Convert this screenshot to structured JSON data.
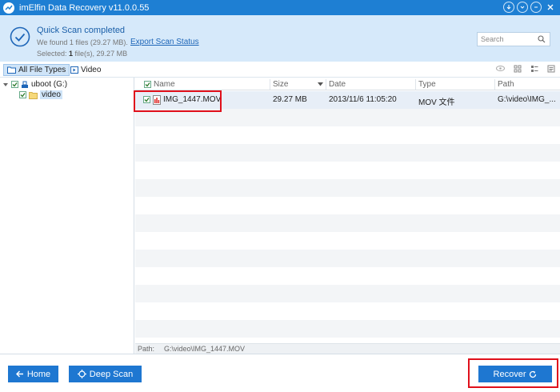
{
  "window": {
    "title": "imElfin Data Recovery v11.0.0.55"
  },
  "header": {
    "status_title": "Quick Scan completed",
    "found_text": "We found 1 files (29.27 MB).",
    "selected_prefix": "Selected: ",
    "selected_count": "1",
    "selected_suffix": " file(s), 29.27 MB",
    "export_link": "Export Scan Status",
    "search_placeholder": "Search"
  },
  "type_tabs": [
    {
      "label": "All File Types",
      "active": true
    },
    {
      "label": "Video",
      "active": false
    }
  ],
  "tree": {
    "drive_label": "uboot (G:)",
    "folder_label": "video"
  },
  "table": {
    "columns": [
      "Name",
      "Size",
      "Date",
      "Type",
      "Path"
    ],
    "rows": [
      {
        "name": "IMG_1447.MOV",
        "size": "29.27 MB",
        "date": "2013/11/6 11:05:20",
        "type": "MOV 文件",
        "path": "G:\\video\\IMG_..."
      }
    ]
  },
  "pathbar": {
    "label": "Path:",
    "value": "G:\\video\\IMG_1447.MOV"
  },
  "footer": {
    "home_label": "Home",
    "deep_scan_label": "Deep Scan",
    "recover_label": "Recover"
  },
  "colors": {
    "accent": "#1e77d1",
    "highlight_border": "#e0101b",
    "header_bg": "#d6e9fa"
  }
}
